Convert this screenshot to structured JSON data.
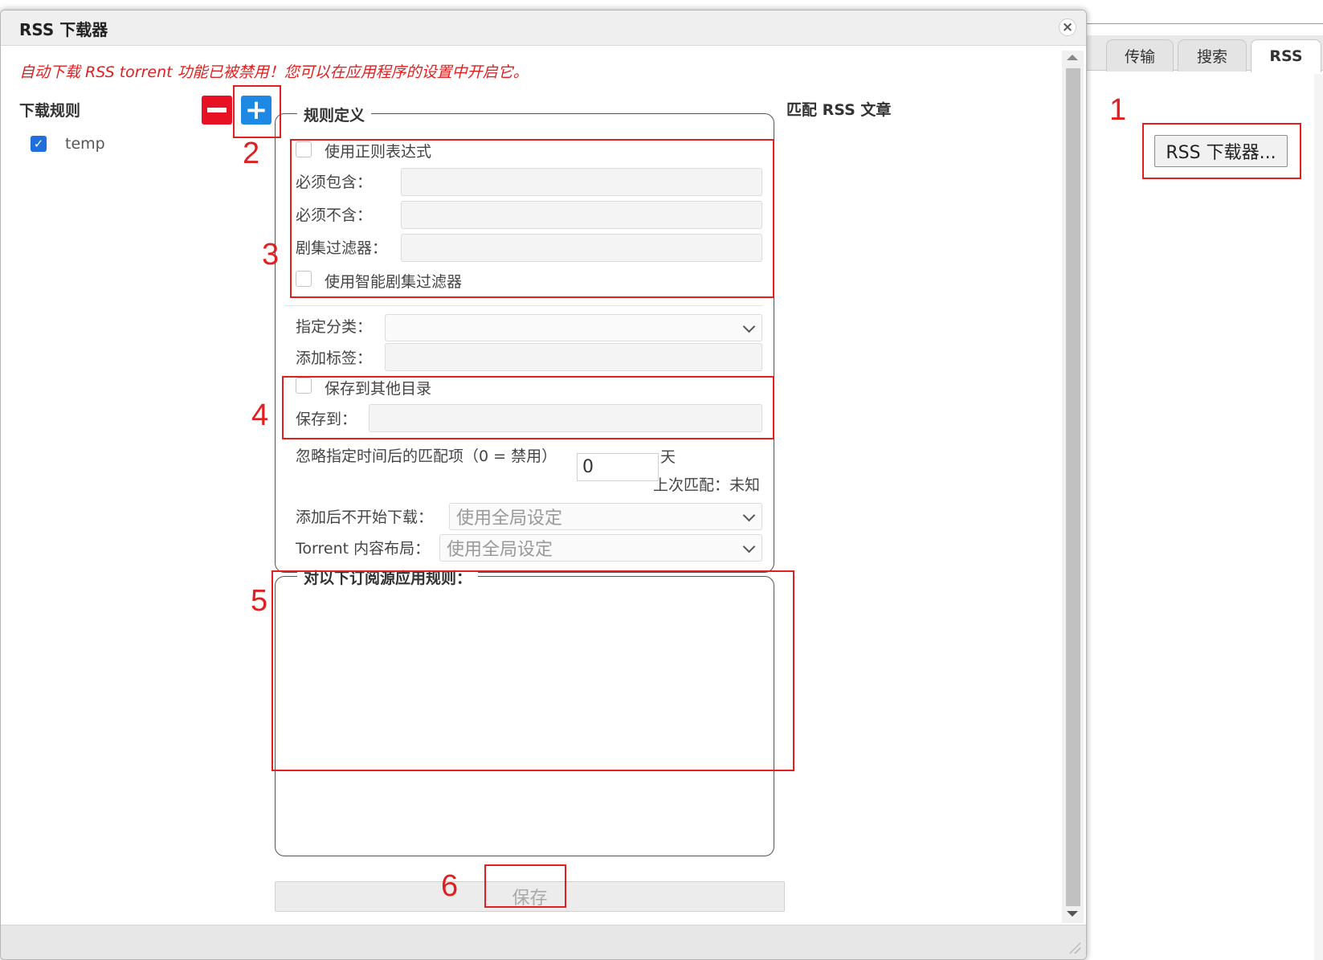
{
  "background": {
    "tabs": [
      {
        "label": "传输",
        "active": false
      },
      {
        "label": "搜索",
        "active": false
      },
      {
        "label": "RSS",
        "active": true
      }
    ],
    "rss_downloader_button": "RSS 下载器..."
  },
  "dialog": {
    "title": "RSS 下载器",
    "close_symbol": "×",
    "warning": "自动下载 RSS torrent 功能已被禁用！您可以在应用程序的设置中开启它。",
    "rules_label": "下载规则",
    "rules": [
      {
        "name": "temp",
        "checked": true
      }
    ],
    "rule_definition": {
      "legend": "规则定义",
      "use_regex": "使用正则表达式",
      "must_contain": "必须包含：",
      "must_not_contain": "必须不含：",
      "episode_filter": "剧集过滤器：",
      "use_smart_episode_filter": "使用智能剧集过滤器",
      "assign_category": "指定分类：",
      "add_tags": "添加标签：",
      "save_to_other_dir": "保存到其他目录",
      "save_to": "保存到：",
      "ignore_after": "忽略指定时间后的匹配项（0 = 禁用）",
      "ignore_days_value": "0",
      "days_unit": "天",
      "last_match": "上次匹配：未知",
      "add_paused": "添加后不开始下载：",
      "add_paused_value": "使用全局设定",
      "content_layout": "Torrent 内容布局：",
      "content_layout_value": "使用全局设定"
    },
    "feeds_legend": "对以下订阅源应用规则：",
    "match_title": "匹配 RSS 文章",
    "save_button": "保存"
  },
  "annotations": [
    "1",
    "2",
    "3",
    "4",
    "5",
    "6"
  ],
  "colors": {
    "annotation": "#e02020",
    "warning": "#e02020",
    "remove_button": "#e81123",
    "add_button": "#1e88e5",
    "checkbox_checked": "#1e6fd9"
  }
}
